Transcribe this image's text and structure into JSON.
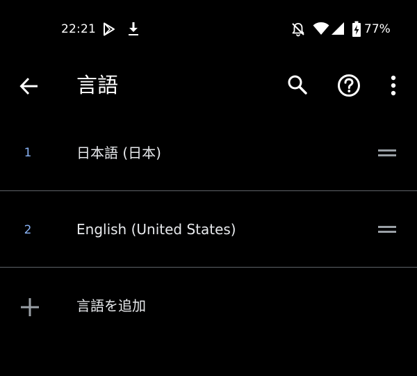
{
  "status_bar": {
    "time": "22:21",
    "battery_level": "77%",
    "icons": [
      "play-store-icon",
      "download-icon",
      "notifications-off-icon",
      "wifi-icon",
      "cell-signal-icon",
      "battery-charging-icon"
    ]
  },
  "app_bar": {
    "title": "言語",
    "icons": [
      "back-arrow-icon",
      "search-icon",
      "help-icon",
      "more-vert-icon"
    ]
  },
  "languages": [
    {
      "index": "1",
      "name": "日本語 (日本)"
    },
    {
      "index": "2",
      "name": "English (United States)"
    }
  ],
  "add_language": {
    "label": "言語を追加",
    "icon": "add-icon"
  },
  "colors": {
    "background": "#000000",
    "text_primary": "#e8eaed",
    "index_accent": "#8ab4f8",
    "divider": "#5f6368",
    "handle": "#9aa0a6"
  }
}
